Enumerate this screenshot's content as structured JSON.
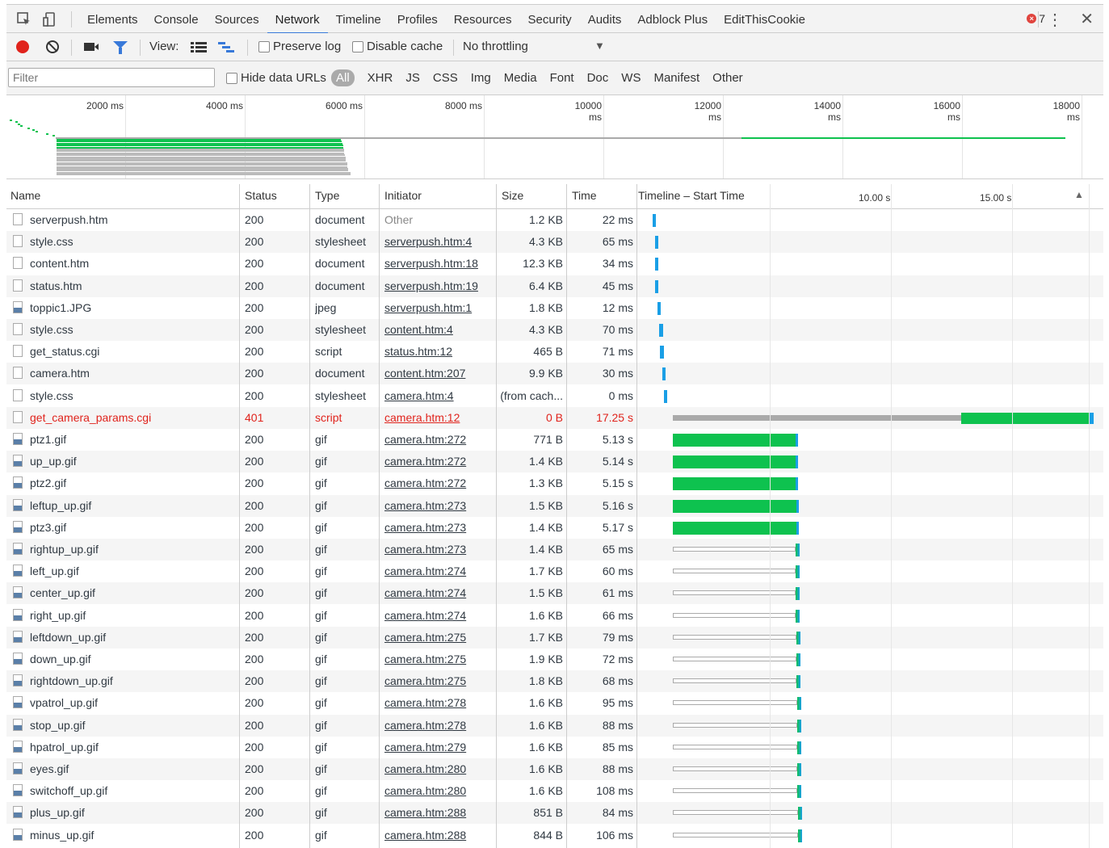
{
  "toolbar": {
    "tabs": [
      "Elements",
      "Console",
      "Sources",
      "Network",
      "Timeline",
      "Profiles",
      "Resources",
      "Security",
      "Audits",
      "Adblock Plus",
      "EditThisCookie"
    ],
    "active_tab": "Network",
    "error_count": "7"
  },
  "network_toolbar": {
    "view_label": "View:",
    "preserve_log": "Preserve log",
    "disable_cache": "Disable cache",
    "throttling": "No throttling"
  },
  "filter_bar": {
    "placeholder": "Filter",
    "hide_data_urls": "Hide data URLs",
    "types": [
      "All",
      "XHR",
      "JS",
      "CSS",
      "Img",
      "Media",
      "Font",
      "Doc",
      "WS",
      "Manifest",
      "Other"
    ]
  },
  "overview": {
    "ticks": [
      "2000 ms",
      "4000 ms",
      "6000 ms",
      "8000 ms",
      "10000 ms",
      "12000 ms",
      "14000 ms",
      "16000 ms",
      "18000 ms"
    ]
  },
  "table": {
    "headers": {
      "name": "Name",
      "status": "Status",
      "type": "Type",
      "initiator": "Initiator",
      "size": "Size",
      "time": "Time",
      "timeline": "Timeline – Start Time",
      "t10": "10.00 s",
      "t15": "15.00 s"
    },
    "rows": [
      {
        "name": "serverpush.htm",
        "status": "200",
        "type": "document",
        "initiator": "Other",
        "size": "1.2 KB",
        "time": "22 ms",
        "start_s": 0.0,
        "end_s": 0.022
      },
      {
        "name": "style.css",
        "status": "200",
        "type": "stylesheet",
        "initiator": "serverpush.htm:4",
        "size": "4.3 KB",
        "time": "65 ms",
        "start_s": 0.05,
        "end_s": 0.115
      },
      {
        "name": "content.htm",
        "status": "200",
        "type": "document",
        "initiator": "serverpush.htm:18",
        "size": "12.3 KB",
        "time": "34 ms",
        "start_s": 0.06,
        "end_s": 0.094
      },
      {
        "name": "status.htm",
        "status": "200",
        "type": "document",
        "initiator": "serverpush.htm:19",
        "size": "6.4 KB",
        "time": "45 ms",
        "start_s": 0.06,
        "end_s": 0.105
      },
      {
        "name": "toppic1.JPG",
        "status": "200",
        "type": "jpeg",
        "initiator": "serverpush.htm:1",
        "size": "1.8 KB",
        "time": "12 ms",
        "start_s": 0.14,
        "end_s": 0.152
      },
      {
        "name": "style.css",
        "status": "200",
        "type": "stylesheet",
        "initiator": "content.htm:4",
        "size": "4.3 KB",
        "time": "70 ms",
        "start_s": 0.18,
        "end_s": 0.25
      },
      {
        "name": "get_status.cgi",
        "status": "200",
        "type": "script",
        "initiator": "status.htm:12",
        "size": "465 B",
        "time": "71 ms",
        "start_s": 0.2,
        "end_s": 0.271
      },
      {
        "name": "camera.htm",
        "status": "200",
        "type": "document",
        "initiator": "content.htm:207",
        "size": "9.9 KB",
        "time": "30 ms",
        "start_s": 0.33,
        "end_s": 0.36
      },
      {
        "name": "style.css",
        "status": "200",
        "type": "stylesheet",
        "initiator": "camera.htm:4",
        "size": "(from cach...",
        "time": "0 ms",
        "start_s": 0.4,
        "end_s": 0.4
      },
      {
        "name": "get_camera_params.cgi",
        "status": "401",
        "type": "script",
        "initiator": "camera.htm:12",
        "size": "0 B",
        "time": "17.25 s",
        "start_s": 0.42,
        "end_s": 17.67,
        "wait_s": 12.25,
        "error": true
      },
      {
        "name": "ptz1.gif",
        "status": "200",
        "type": "gif",
        "initiator": "camera.htm:272",
        "size": "771 B",
        "time": "5.13 s",
        "start_s": 0.42,
        "end_s": 5.55,
        "wait_s": 5.45
      },
      {
        "name": "up_up.gif",
        "status": "200",
        "type": "gif",
        "initiator": "camera.htm:272",
        "size": "1.4 KB",
        "time": "5.14 s",
        "start_s": 0.42,
        "end_s": 5.56,
        "wait_s": 5.48
      },
      {
        "name": "ptz2.gif",
        "status": "200",
        "type": "gif",
        "initiator": "camera.htm:272",
        "size": "1.3 KB",
        "time": "5.15 s",
        "start_s": 0.42,
        "end_s": 5.57,
        "wait_s": 5.49
      },
      {
        "name": "leftup_up.gif",
        "status": "200",
        "type": "gif",
        "initiator": "camera.htm:273",
        "size": "1.5 KB",
        "time": "5.16 s",
        "start_s": 0.42,
        "end_s": 5.58,
        "wait_s": 5.5
      },
      {
        "name": "ptz3.gif",
        "status": "200",
        "type": "gif",
        "initiator": "camera.htm:273",
        "size": "1.4 KB",
        "time": "5.17 s",
        "start_s": 0.42,
        "end_s": 5.59,
        "wait_s": 5.52
      },
      {
        "name": "rightup_up.gif",
        "status": "200",
        "type": "gif",
        "initiator": "camera.htm:273",
        "size": "1.4 KB",
        "time": "65 ms",
        "start_s": 0.42,
        "end_s": 5.6,
        "stalled": true
      },
      {
        "name": "left_up.gif",
        "status": "200",
        "type": "gif",
        "initiator": "camera.htm:274",
        "size": "1.7 KB",
        "time": "60 ms",
        "start_s": 0.42,
        "end_s": 5.6,
        "stalled": true
      },
      {
        "name": "center_up.gif",
        "status": "200",
        "type": "gif",
        "initiator": "camera.htm:274",
        "size": "1.5 KB",
        "time": "61 ms",
        "start_s": 0.42,
        "end_s": 5.6,
        "stalled": true
      },
      {
        "name": "right_up.gif",
        "status": "200",
        "type": "gif",
        "initiator": "camera.htm:274",
        "size": "1.6 KB",
        "time": "66 ms",
        "start_s": 0.42,
        "end_s": 5.61,
        "stalled": true
      },
      {
        "name": "leftdown_up.gif",
        "status": "200",
        "type": "gif",
        "initiator": "camera.htm:275",
        "size": "1.7 KB",
        "time": "79 ms",
        "start_s": 0.42,
        "end_s": 5.63,
        "stalled": true
      },
      {
        "name": "down_up.gif",
        "status": "200",
        "type": "gif",
        "initiator": "camera.htm:275",
        "size": "1.9 KB",
        "time": "72 ms",
        "start_s": 0.42,
        "end_s": 5.63,
        "stalled": true
      },
      {
        "name": "rightdown_up.gif",
        "status": "200",
        "type": "gif",
        "initiator": "camera.htm:275",
        "size": "1.8 KB",
        "time": "68 ms",
        "start_s": 0.42,
        "end_s": 5.63,
        "stalled": true
      },
      {
        "name": "vpatrol_up.gif",
        "status": "200",
        "type": "gif",
        "initiator": "camera.htm:278",
        "size": "1.6 KB",
        "time": "95 ms",
        "start_s": 0.42,
        "end_s": 5.65,
        "stalled": true
      },
      {
        "name": "stop_up.gif",
        "status": "200",
        "type": "gif",
        "initiator": "camera.htm:278",
        "size": "1.6 KB",
        "time": "88 ms",
        "start_s": 0.42,
        "end_s": 5.65,
        "stalled": true
      },
      {
        "name": "hpatrol_up.gif",
        "status": "200",
        "type": "gif",
        "initiator": "camera.htm:279",
        "size": "1.6 KB",
        "time": "85 ms",
        "start_s": 0.42,
        "end_s": 5.65,
        "stalled": true
      },
      {
        "name": "eyes.gif",
        "status": "200",
        "type": "gif",
        "initiator": "camera.htm:280",
        "size": "1.6 KB",
        "time": "88 ms",
        "start_s": 0.42,
        "end_s": 5.66,
        "stalled": true
      },
      {
        "name": "switchoff_up.gif",
        "status": "200",
        "type": "gif",
        "initiator": "camera.htm:280",
        "size": "1.6 KB",
        "time": "108 ms",
        "start_s": 0.42,
        "end_s": 5.66,
        "stalled": true
      },
      {
        "name": "plus_up.gif",
        "status": "200",
        "type": "gif",
        "initiator": "camera.htm:288",
        "size": "851 B",
        "time": "84 ms",
        "start_s": 0.42,
        "end_s": 5.7,
        "stalled": true
      },
      {
        "name": "minus_up.gif",
        "status": "200",
        "type": "gif",
        "initiator": "camera.htm:288",
        "size": "844 B",
        "time": "106 ms",
        "start_s": 0.42,
        "end_s": 5.7,
        "stalled": true
      }
    ]
  },
  "colors": {
    "accent": "#3879d9",
    "error": "#e0231c",
    "waiting": "#0ec24f",
    "receiving": "#1a9fe6",
    "stalled": "#aaaaaa"
  }
}
